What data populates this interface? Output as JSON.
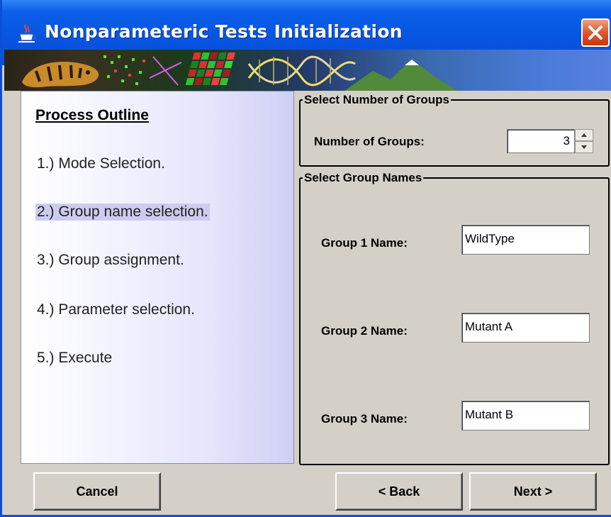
{
  "window": {
    "title": "Nonparameteric Tests Initialization"
  },
  "outline": {
    "heading": "Process Outline",
    "steps": [
      "1.) Mode Selection.",
      "2.) Group name selection.",
      "3.) Group assignment.",
      "4.) Parameter selection.",
      "5.) Execute"
    ],
    "active_step": 2
  },
  "groups_count": {
    "legend": "Select Number of Groups",
    "label": "Number of Groups:",
    "value": "3"
  },
  "group_names": {
    "legend": "Select Group Names",
    "groups": [
      {
        "label": "Group 1 Name:",
        "value": "WildType"
      },
      {
        "label": "Group 2 Name:",
        "value": "Mutant A"
      },
      {
        "label": "Group 3 Name:",
        "value": "Mutant B"
      }
    ]
  },
  "buttons": {
    "cancel": "Cancel",
    "back": "< Back",
    "next": "Next >"
  },
  "icons": {
    "app": "java-cup-icon",
    "close": "close-icon",
    "spin_up": "arrow-up-icon",
    "spin_down": "arrow-down-icon"
  },
  "colors": {
    "titlebar": "#0a5fe8",
    "close": "#e0562e",
    "panel_bg": "#d4d0c8",
    "active_step_highlight": "#ccccf0"
  }
}
